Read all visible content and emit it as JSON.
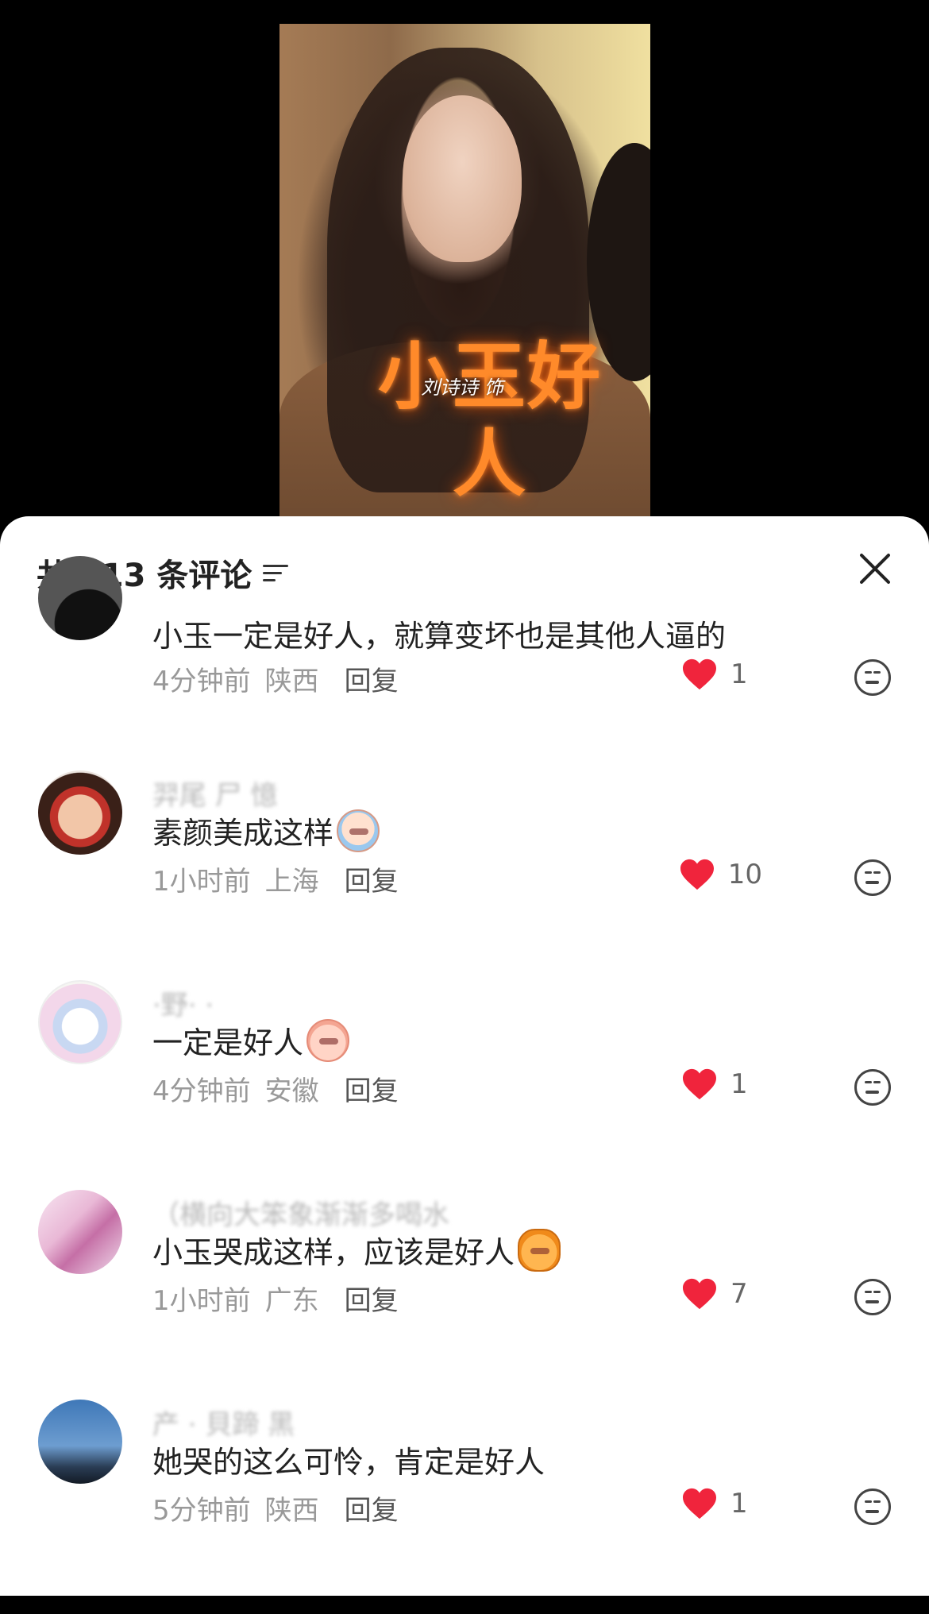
{
  "video": {
    "overlay_title": "小玉好人",
    "overlay_subtitle": "刘诗诗 饰"
  },
  "sheet": {
    "title": "共 113 条评论",
    "sort_icon": "sort-icon",
    "close_icon": "close-icon"
  },
  "comments": [
    {
      "username": "",
      "text": "小玉一定是好人，就算变坏也是其他人逼的",
      "time": "4分钟前",
      "location": "陕西",
      "reply": "回复",
      "likes": "1",
      "sticker": ""
    },
    {
      "username": "羿尾 尸 憶",
      "text": "素颜美成这样",
      "time": "1小时前",
      "location": "上海",
      "reply": "回复",
      "likes": "10",
      "sticker": "cry"
    },
    {
      "username": "·野· ·",
      "text": "一定是好人",
      "time": "4分钟前",
      "location": "安徽",
      "reply": "回复",
      "likes": "1",
      "sticker": "peach"
    },
    {
      "username": "（横向大笨象渐渐多喝水",
      "text": "小玉哭成这样，应该是好人",
      "time": "1小时前",
      "location": "广东",
      "reply": "回复",
      "likes": "7",
      "sticker": "cat"
    },
    {
      "username": "产 · 貝蹄 黑",
      "text": "她哭的这么可怜，肯定是好人",
      "time": "5分钟前",
      "location": "陕西",
      "reply": "回复",
      "likes": "1",
      "sticker": ""
    }
  ],
  "colors": {
    "heart": "#f0243c",
    "text": "#222222",
    "meta": "#999999"
  }
}
